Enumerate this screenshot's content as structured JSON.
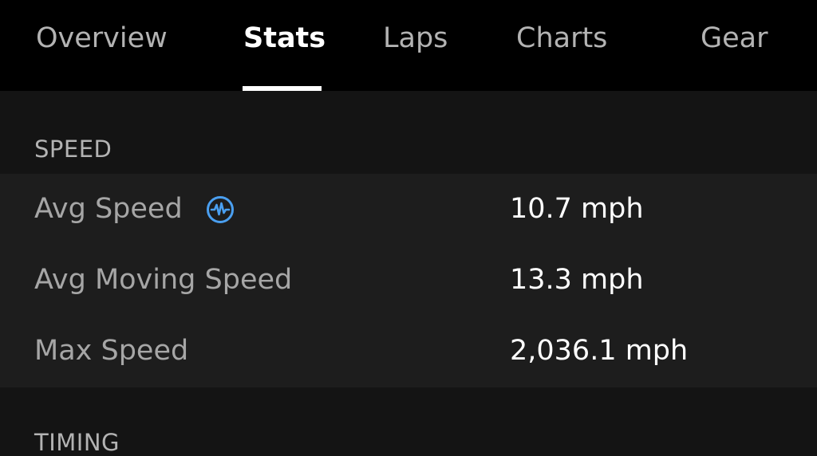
{
  "tabs": [
    {
      "label": "Overview",
      "active": false
    },
    {
      "label": "Stats",
      "active": true
    },
    {
      "label": "Laps",
      "active": false
    },
    {
      "label": "Charts",
      "active": false
    },
    {
      "label": "Gear",
      "active": false
    }
  ],
  "sections": {
    "speed": {
      "title": "SPEED",
      "rows": [
        {
          "label": "Avg Speed",
          "value": "10.7 mph",
          "icon": "activity-chart-icon"
        },
        {
          "label": "Avg Moving Speed",
          "value": "13.3 mph"
        },
        {
          "label": "Max Speed",
          "value": "2,036.1 mph"
        }
      ]
    },
    "timing": {
      "title": "TIMING"
    }
  },
  "colors": {
    "background": "#141414",
    "tabbar": "#000000",
    "card": "#1d1d1d",
    "accent_icon": "#4a9ff0",
    "text_primary": "#ffffff",
    "text_secondary": "#a6a6a6"
  }
}
